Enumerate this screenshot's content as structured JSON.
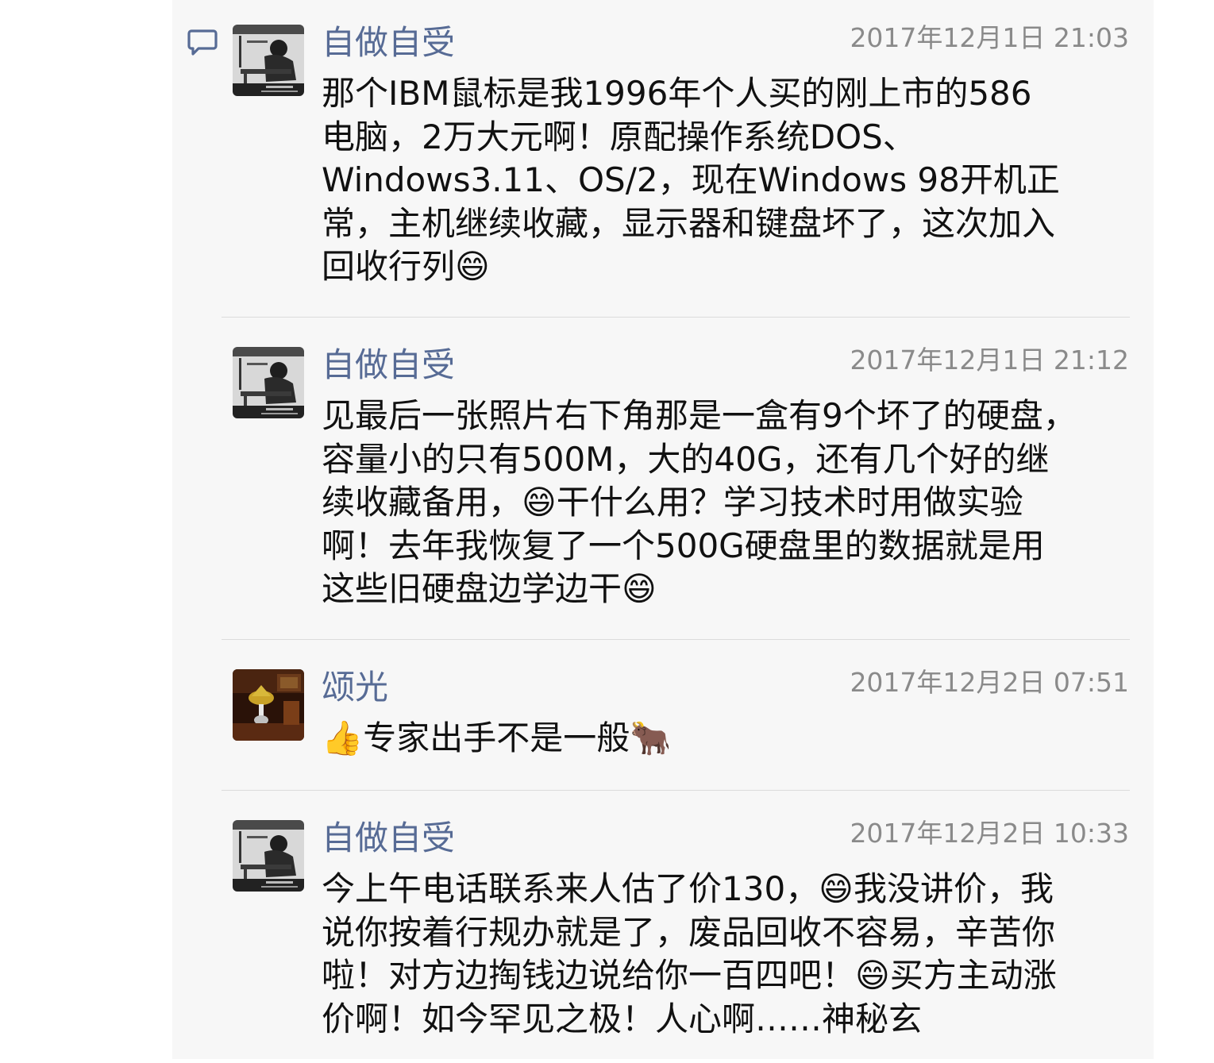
{
  "comments": [
    {
      "author": "自做自受",
      "time": "2017年12月1日 21:03",
      "text": "那个IBM鼠标是我1996年个人买的刚上市的586\n电脑，2万大元啊！原配操作系统DOS、\nWindows3.11、OS/2，现在Windows 98开机正\n常，主机继续收藏，显示器和键盘坏了，这次加入\n回收行列😄"
    },
    {
      "author": "自做自受",
      "time": "2017年12月1日 21:12",
      "text": "见最后一张照片右下角那是一盒有9个坏了的硬盘，\n容量小的只有500M，大的40G，还有几个好的继\n续收藏备用，😄干什么用？学习技术时用做实验\n啊！去年我恢复了一个500G硬盘里的数据就是用\n这些旧硬盘边学边干😄"
    },
    {
      "author": "颂光",
      "time": "2017年12月2日 07:51",
      "text": "👍专家出手不是一般🐂"
    },
    {
      "author": "自做自受",
      "time": "2017年12月2日 10:33",
      "text": "今上午电话联系来人估了价130，😄我没讲价，我\n说你按着行规办就是了，废品回收不容易，辛苦你\n啦！对方边掏钱边说给你一百四吧！😄买方主动涨\n价啊！如今罕见之极！人心啊……神秘玄"
    }
  ]
}
